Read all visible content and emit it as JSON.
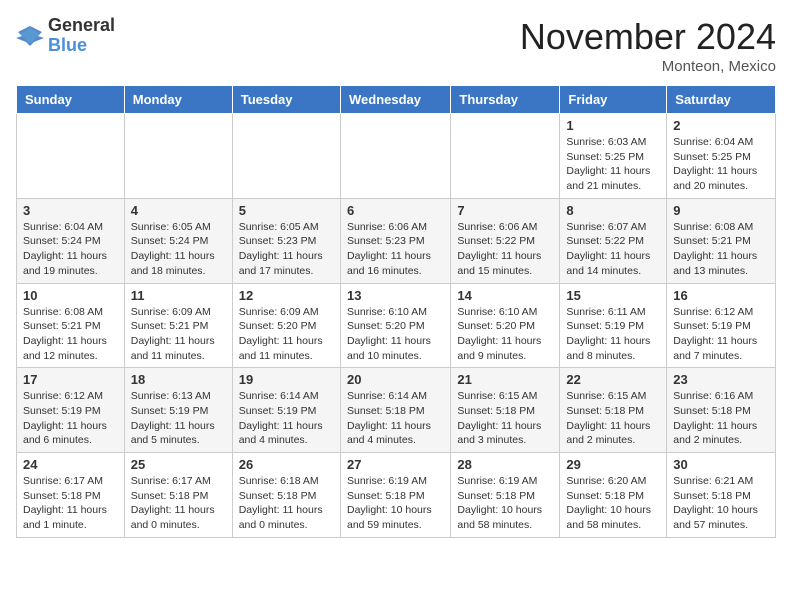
{
  "logo": {
    "general": "General",
    "blue": "Blue"
  },
  "title": "November 2024",
  "location": "Monteon, Mexico",
  "days_of_week": [
    "Sunday",
    "Monday",
    "Tuesday",
    "Wednesday",
    "Thursday",
    "Friday",
    "Saturday"
  ],
  "weeks": [
    [
      {
        "day": "",
        "info": ""
      },
      {
        "day": "",
        "info": ""
      },
      {
        "day": "",
        "info": ""
      },
      {
        "day": "",
        "info": ""
      },
      {
        "day": "",
        "info": ""
      },
      {
        "day": "1",
        "info": "Sunrise: 6:03 AM\nSunset: 5:25 PM\nDaylight: 11 hours and 21 minutes."
      },
      {
        "day": "2",
        "info": "Sunrise: 6:04 AM\nSunset: 5:25 PM\nDaylight: 11 hours and 20 minutes."
      }
    ],
    [
      {
        "day": "3",
        "info": "Sunrise: 6:04 AM\nSunset: 5:24 PM\nDaylight: 11 hours and 19 minutes."
      },
      {
        "day": "4",
        "info": "Sunrise: 6:05 AM\nSunset: 5:24 PM\nDaylight: 11 hours and 18 minutes."
      },
      {
        "day": "5",
        "info": "Sunrise: 6:05 AM\nSunset: 5:23 PM\nDaylight: 11 hours and 17 minutes."
      },
      {
        "day": "6",
        "info": "Sunrise: 6:06 AM\nSunset: 5:23 PM\nDaylight: 11 hours and 16 minutes."
      },
      {
        "day": "7",
        "info": "Sunrise: 6:06 AM\nSunset: 5:22 PM\nDaylight: 11 hours and 15 minutes."
      },
      {
        "day": "8",
        "info": "Sunrise: 6:07 AM\nSunset: 5:22 PM\nDaylight: 11 hours and 14 minutes."
      },
      {
        "day": "9",
        "info": "Sunrise: 6:08 AM\nSunset: 5:21 PM\nDaylight: 11 hours and 13 minutes."
      }
    ],
    [
      {
        "day": "10",
        "info": "Sunrise: 6:08 AM\nSunset: 5:21 PM\nDaylight: 11 hours and 12 minutes."
      },
      {
        "day": "11",
        "info": "Sunrise: 6:09 AM\nSunset: 5:21 PM\nDaylight: 11 hours and 11 minutes."
      },
      {
        "day": "12",
        "info": "Sunrise: 6:09 AM\nSunset: 5:20 PM\nDaylight: 11 hours and 11 minutes."
      },
      {
        "day": "13",
        "info": "Sunrise: 6:10 AM\nSunset: 5:20 PM\nDaylight: 11 hours and 10 minutes."
      },
      {
        "day": "14",
        "info": "Sunrise: 6:10 AM\nSunset: 5:20 PM\nDaylight: 11 hours and 9 minutes."
      },
      {
        "day": "15",
        "info": "Sunrise: 6:11 AM\nSunset: 5:19 PM\nDaylight: 11 hours and 8 minutes."
      },
      {
        "day": "16",
        "info": "Sunrise: 6:12 AM\nSunset: 5:19 PM\nDaylight: 11 hours and 7 minutes."
      }
    ],
    [
      {
        "day": "17",
        "info": "Sunrise: 6:12 AM\nSunset: 5:19 PM\nDaylight: 11 hours and 6 minutes."
      },
      {
        "day": "18",
        "info": "Sunrise: 6:13 AM\nSunset: 5:19 PM\nDaylight: 11 hours and 5 minutes."
      },
      {
        "day": "19",
        "info": "Sunrise: 6:14 AM\nSunset: 5:19 PM\nDaylight: 11 hours and 4 minutes."
      },
      {
        "day": "20",
        "info": "Sunrise: 6:14 AM\nSunset: 5:18 PM\nDaylight: 11 hours and 4 minutes."
      },
      {
        "day": "21",
        "info": "Sunrise: 6:15 AM\nSunset: 5:18 PM\nDaylight: 11 hours and 3 minutes."
      },
      {
        "day": "22",
        "info": "Sunrise: 6:15 AM\nSunset: 5:18 PM\nDaylight: 11 hours and 2 minutes."
      },
      {
        "day": "23",
        "info": "Sunrise: 6:16 AM\nSunset: 5:18 PM\nDaylight: 11 hours and 2 minutes."
      }
    ],
    [
      {
        "day": "24",
        "info": "Sunrise: 6:17 AM\nSunset: 5:18 PM\nDaylight: 11 hours and 1 minute."
      },
      {
        "day": "25",
        "info": "Sunrise: 6:17 AM\nSunset: 5:18 PM\nDaylight: 11 hours and 0 minutes."
      },
      {
        "day": "26",
        "info": "Sunrise: 6:18 AM\nSunset: 5:18 PM\nDaylight: 11 hours and 0 minutes."
      },
      {
        "day": "27",
        "info": "Sunrise: 6:19 AM\nSunset: 5:18 PM\nDaylight: 10 hours and 59 minutes."
      },
      {
        "day": "28",
        "info": "Sunrise: 6:19 AM\nSunset: 5:18 PM\nDaylight: 10 hours and 58 minutes."
      },
      {
        "day": "29",
        "info": "Sunrise: 6:20 AM\nSunset: 5:18 PM\nDaylight: 10 hours and 58 minutes."
      },
      {
        "day": "30",
        "info": "Sunrise: 6:21 AM\nSunset: 5:18 PM\nDaylight: 10 hours and 57 minutes."
      }
    ]
  ]
}
